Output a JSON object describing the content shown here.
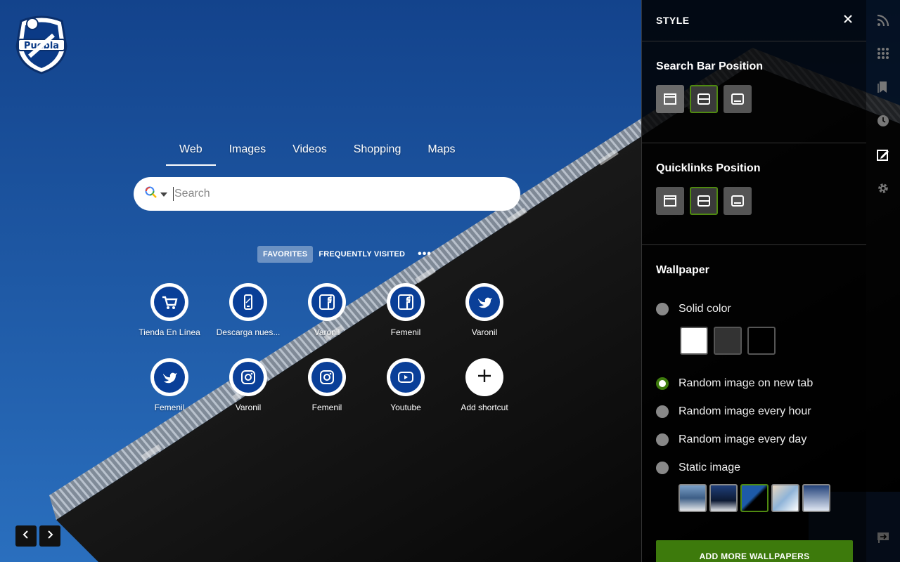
{
  "search": {
    "tabs": [
      "Web",
      "Images",
      "Videos",
      "Shopping",
      "Maps"
    ],
    "placeholder": "Search"
  },
  "quicklinks": {
    "tab_favorites": "FAVORITES",
    "tab_frequent": "FREQUENTLY VISITED",
    "more": "•••",
    "items": [
      {
        "label": "Tienda En Línea",
        "icon": "cart-icon"
      },
      {
        "label": "Descarga nues...",
        "icon": "phone-icon"
      },
      {
        "label": "Varonil",
        "icon": "facebook-icon"
      },
      {
        "label": "Femenil",
        "icon": "facebook-icon"
      },
      {
        "label": "Varonil",
        "icon": "twitter-icon"
      },
      {
        "label": "Femenil",
        "icon": "twitter-icon"
      },
      {
        "label": "Varonil",
        "icon": "instagram-icon"
      },
      {
        "label": "Femenil",
        "icon": "instagram-icon"
      },
      {
        "label": "Youtube",
        "icon": "youtube-icon"
      },
      {
        "label": "Add shortcut",
        "icon": "plus-icon"
      }
    ]
  },
  "panel": {
    "title": "STYLE",
    "search_bar_position": "Search Bar Position",
    "quicklinks_position": "Quicklinks Position",
    "wallpaper": "Wallpaper",
    "options": {
      "solid": "Solid color",
      "random_tab": "Random image on new tab",
      "random_hour": "Random image every hour",
      "random_day": "Random image every day",
      "static": "Static image"
    },
    "selected_option": "random_tab",
    "swatches": [
      "#ffffff",
      "#333333",
      "#000000"
    ],
    "add_more": "ADD MORE WALLPAPERS"
  },
  "colors": {
    "accent": "#3d7a0c",
    "panel_bg": "#0d0d0d"
  }
}
